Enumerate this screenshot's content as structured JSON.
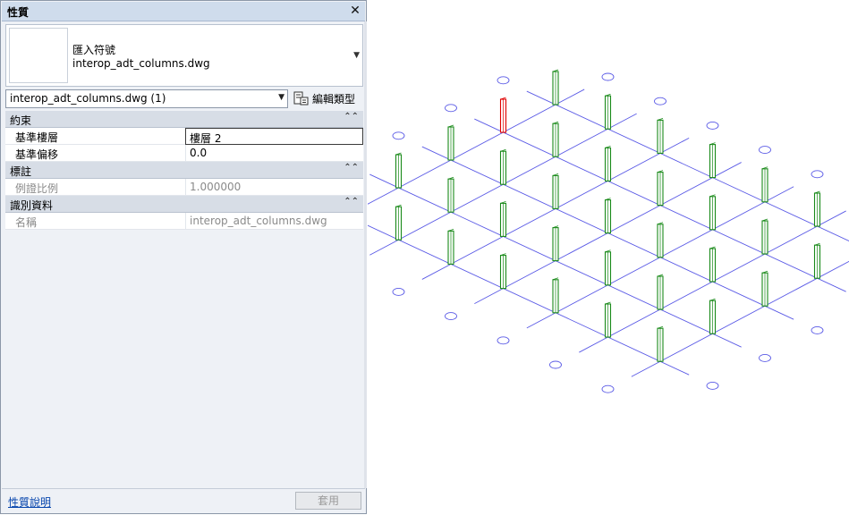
{
  "palette": {
    "title": "性質",
    "close_glyph": "✕",
    "type_family": "匯入符號",
    "type_name": "interop_adt_columns.dwg",
    "selector_value": "interop_adt_columns.dwg (1)",
    "edit_type_label": "編輯類型",
    "groups": {
      "constraints": "約束",
      "graphics": "標註",
      "identity": "識別資料"
    },
    "props": {
      "base_level_label": "基準樓層",
      "base_level_value": "樓層 2",
      "base_offset_label": "基準偏移",
      "base_offset_value": "0.0",
      "scale_label": "例證比例",
      "scale_value": "1.000000",
      "name_label": "名稱",
      "name_value": "interop_adt_columns.dwg"
    },
    "help_link": "性質說明",
    "apply_label": "套用"
  },
  "viewport": {
    "grid_color": "#5a5ae6",
    "column_color": "#1a8a1a",
    "selected_color": "#e00000"
  }
}
